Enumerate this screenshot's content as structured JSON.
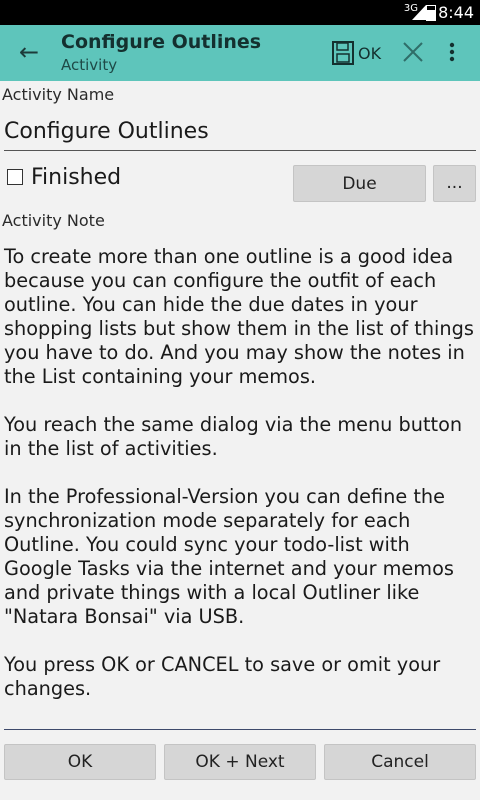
{
  "status_bar": {
    "network": "3G",
    "time": "8:44"
  },
  "action_bar": {
    "title": "Configure Outlines",
    "subtitle": "Activity",
    "ok_label": "OK"
  },
  "form": {
    "activity_name_label": "Activity Name",
    "activity_name_value": "Configure Outlines",
    "finished_label": "Finished",
    "finished_checked": false,
    "due_button": "Due",
    "more_button": "...",
    "activity_note_label": "Activity Note",
    "activity_note_value": "To create more than one outline is a good idea because you can configure the outfit of each outline. You can hide the due dates in your shopping lists but show them in the list of things you have to do. And you may show the notes in the List containing your memos.\n\nYou reach the same dialog via the menu button in the list of activities.\n\nIn the Professional-Version you can define the synchronization mode separately for each Outline. You could sync your todo-list with Google Tasks via the internet and your memos and private things with a local Outliner like \"Natara Bonsai\" via USB.\n\nYou press OK or CANCEL to save or omit your changes."
  },
  "footer": {
    "ok": "OK",
    "ok_next": "OK + Next",
    "cancel": "Cancel"
  }
}
